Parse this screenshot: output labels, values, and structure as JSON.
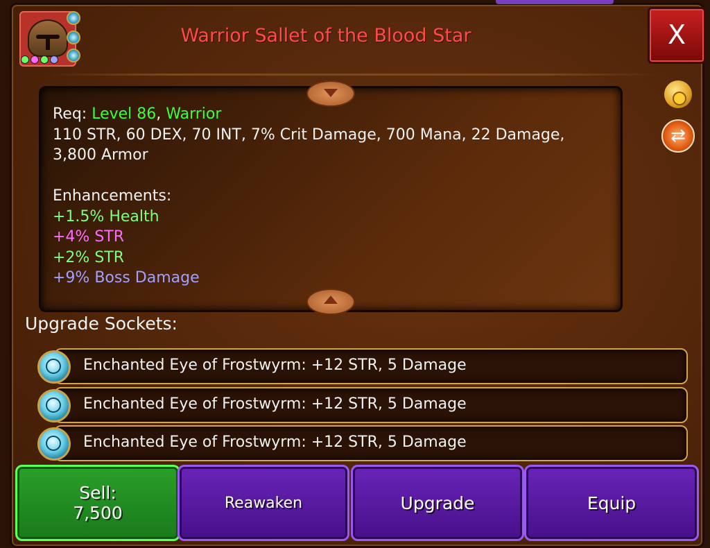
{
  "header": {
    "title": "Warrior Sallet of the Blood Star",
    "close_label": "X"
  },
  "colors": {
    "title": "#ff4a4a",
    "green_text": "#3cff3c",
    "pink_text": "#ff6aff",
    "light_green_text": "#7cff7c",
    "lavender_text": "#a0a0ff"
  },
  "item_icon": {
    "name": "sallet-helmet-icon"
  },
  "requirements": {
    "label": "Req:",
    "level": "Level 86",
    "class": "Warrior",
    "stats_line1": "110 STR, 60 DEX, 70 INT, 7% Crit Damage, 700 Mana, 22 Damage,",
    "stats_line2": "3,800 Armor"
  },
  "enhancements": {
    "label": "Enhancements:",
    "items": [
      {
        "text": "+1.5% Health",
        "color": "#7cff7c"
      },
      {
        "text": "+4% STR",
        "color": "#ff6aff"
      },
      {
        "text": "+2% STR",
        "color": "#7cff7c"
      },
      {
        "text": "+9% Boss Damage",
        "color": "#a0a0ff"
      }
    ]
  },
  "sockets": {
    "label": "Upgrade Sockets:",
    "items": [
      {
        "text": "Enchanted Eye of Frostwyrm: +12 STR, 5 Damage"
      },
      {
        "text": "Enchanted Eye of Frostwyrm: +12 STR, 5 Damage"
      },
      {
        "text": "Enchanted Eye of Frostwyrm: +12 STR, 5 Damage"
      }
    ]
  },
  "buttons": {
    "sell_label": "Sell:",
    "sell_price": "7,500",
    "reawaken": "Reawaken",
    "upgrade": "Upgrade",
    "equip": "Equip"
  },
  "side_icons": [
    "gold-bag-icon",
    "swap-icon"
  ]
}
